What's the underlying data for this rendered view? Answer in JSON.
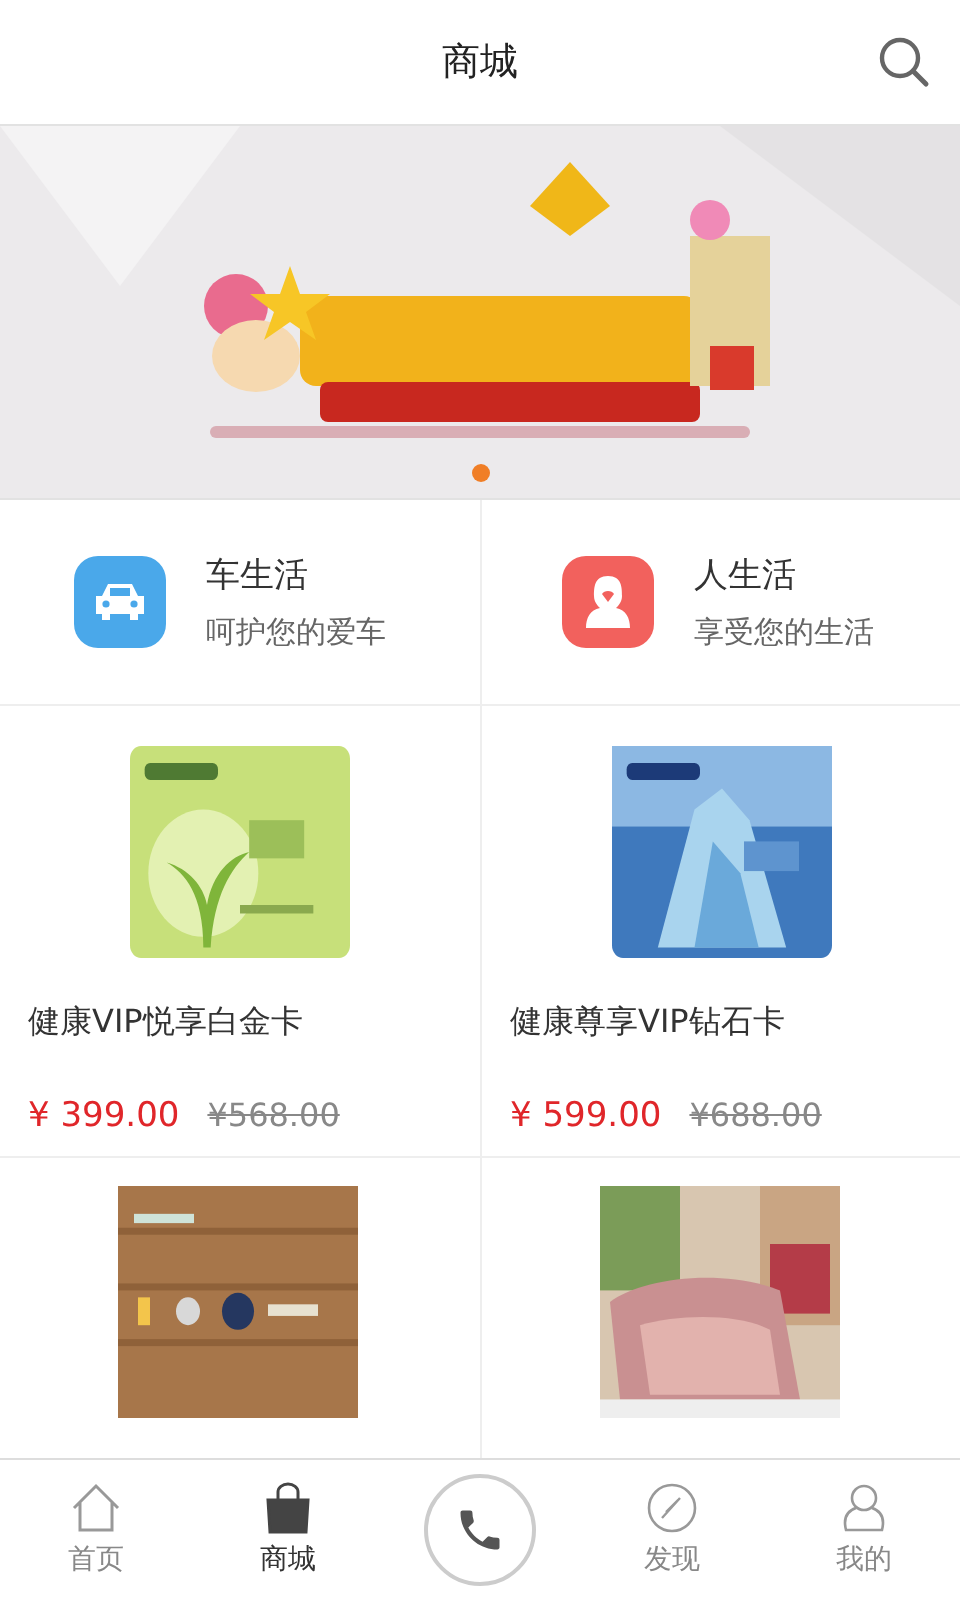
{
  "header": {
    "title": "商城"
  },
  "banner": {
    "kind": "picture",
    "dots": [
      {
        "selected": true
      }
    ]
  },
  "categories": [
    {
      "kind": "car",
      "title": "车生活",
      "subtitle": "呵护您的爱车",
      "color": "#4aa8ea"
    },
    {
      "kind": "person",
      "title": "人生活",
      "subtitle": "享受您的生活",
      "color": "#f2615d"
    }
  ],
  "products": [
    {
      "kind": "green-card",
      "title": "健康VIP悦享白金卡",
      "price": "¥ 399.00",
      "original_price": "¥568.00"
    },
    {
      "kind": "blue-card",
      "title": "健康尊享VIP钻石卡",
      "price": "¥ 599.00",
      "original_price": "¥688.00"
    },
    {
      "kind": "wood"
    },
    {
      "kind": "bedding"
    }
  ],
  "nav": [
    {
      "kind": "home",
      "label": "首页",
      "selected": false
    },
    {
      "kind": "bag",
      "label": "商城",
      "selected": true
    },
    {
      "kind": "call",
      "selected": false
    },
    {
      "kind": "compass",
      "label": "发现",
      "selected": false
    },
    {
      "kind": "user",
      "label": "我的",
      "selected": false
    }
  ]
}
